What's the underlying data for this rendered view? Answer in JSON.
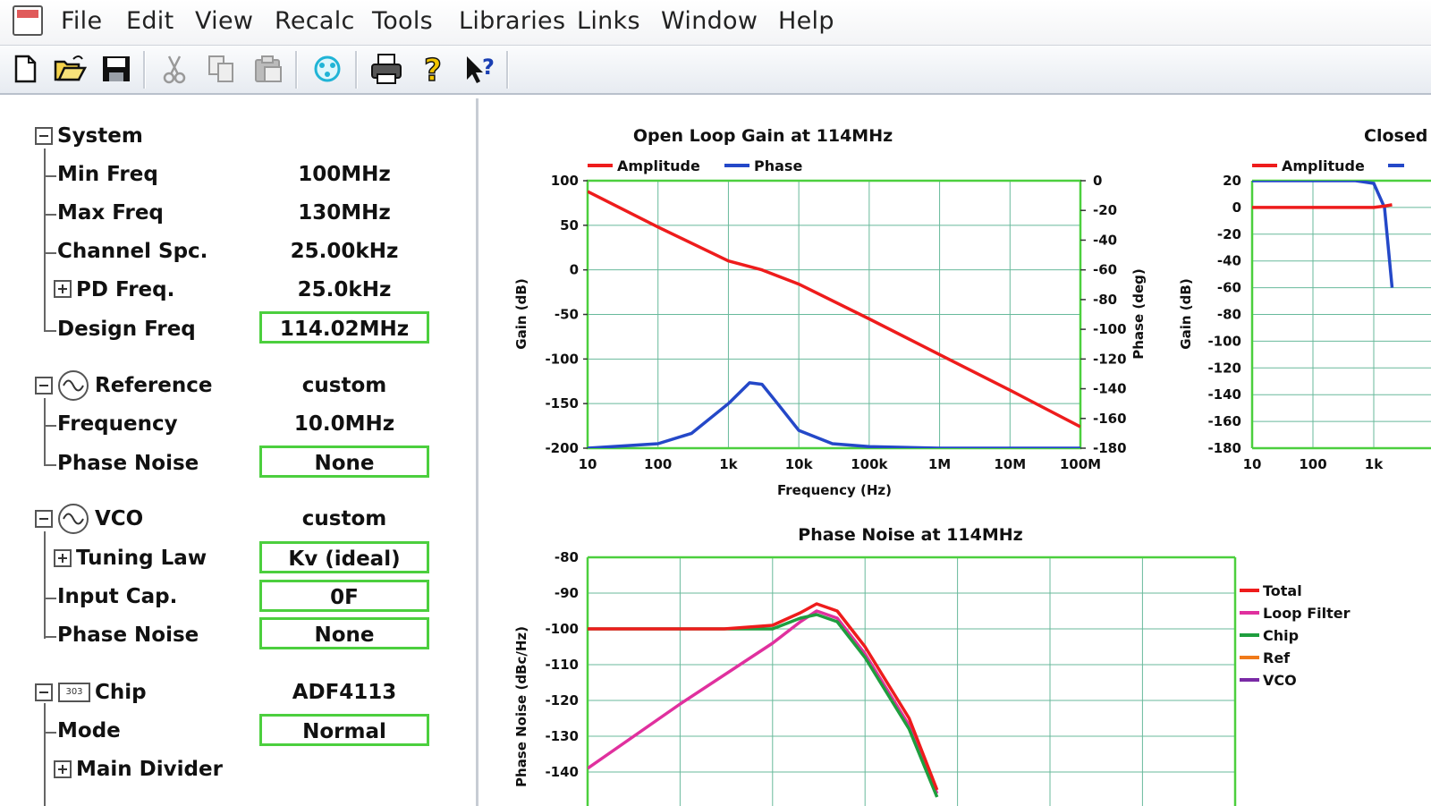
{
  "menu": [
    "File",
    "Edit",
    "View",
    "Recalc",
    "Tools",
    "Libraries",
    "Links",
    "Window",
    "Help"
  ],
  "toolbar": {
    "icons": [
      "new-file-icon",
      "open-folder-icon",
      "save-icon",
      "cut-icon",
      "copy-icon",
      "paste-icon",
      "calculate-icon",
      "print-icon",
      "help-icon",
      "context-help-icon"
    ]
  },
  "tree": {
    "system": {
      "label": "System",
      "rows": [
        {
          "label": "Min Freq",
          "value": "100MHz",
          "boxed": false
        },
        {
          "label": "Max Freq",
          "value": "130MHz",
          "boxed": false
        },
        {
          "label": "Channel Spc.",
          "value": "25.00kHz",
          "boxed": false
        },
        {
          "label": "PD Freq.",
          "value": "25.0kHz",
          "boxed": false
        },
        {
          "label": "Design Freq",
          "value": "114.02MHz",
          "boxed": true
        }
      ]
    },
    "reference": {
      "label": "Reference",
      "value": "custom",
      "rows": [
        {
          "label": "Frequency",
          "value": "10.0MHz",
          "boxed": false
        },
        {
          "label": "Phase Noise",
          "value": "None",
          "boxed": true
        }
      ]
    },
    "vco": {
      "label": "VCO",
      "value": "custom",
      "rows": [
        {
          "label": "Tuning Law",
          "value": "Kv (ideal)",
          "boxed": true
        },
        {
          "label": "Input Cap.",
          "value": "0F",
          "boxed": true
        },
        {
          "label": "Phase Noise",
          "value": "None",
          "boxed": true
        }
      ]
    },
    "chip": {
      "label": "Chip",
      "value": "ADF4113",
      "icon_text": "303",
      "rows": [
        {
          "label": "Mode",
          "value": "Normal",
          "boxed": true
        },
        {
          "label": "Main Divider",
          "value": "",
          "boxed": false
        }
      ]
    }
  },
  "colors": {
    "amplitude": "#ee1c1c",
    "phase": "#2448c8",
    "total": "#ee1c1c",
    "loop_filter": "#e0309e",
    "chip": "#1e9e3e",
    "ref": "#f07a1a",
    "vco": "#7a2aa6",
    "grid": "#68b99b",
    "frame": "#4ccf3e"
  },
  "chart_data": [
    {
      "type": "line",
      "title": "Open Loop Gain at  114MHz",
      "xlabel": "Frequency (Hz)",
      "ylabel": "Gain (dB)",
      "y2label": "Phase (deg)",
      "xscale": "log",
      "x_ticks": [
        "10",
        "100",
        "1k",
        "10k",
        "100k",
        "1M",
        "10M",
        "100M"
      ],
      "y_ticks": [
        "100",
        "50",
        "0",
        "-50",
        "-100",
        "-150",
        "-200"
      ],
      "y2_ticks": [
        "0",
        "-20",
        "-40",
        "-60",
        "-80",
        "-100",
        "-120",
        "-140",
        "-160",
        "-180"
      ],
      "ylim": [
        -200,
        100
      ],
      "y2lim": [
        -180,
        0
      ],
      "legend_position": "top-left",
      "series": [
        {
          "name": "Amplitude",
          "axis": "left",
          "x": [
            10,
            100,
            1000,
            3000,
            10000,
            100000,
            1000000,
            10000000,
            100000000
          ],
          "values": [
            88,
            48,
            10,
            0,
            -16,
            -55,
            -95,
            -135,
            -176
          ]
        },
        {
          "name": "Phase",
          "axis": "right",
          "x": [
            10,
            100,
            300,
            1000,
            2000,
            3000,
            5000,
            10000,
            30000,
            100000,
            1000000,
            10000000,
            100000000
          ],
          "values": [
            -180,
            -177,
            -170,
            -150,
            -136,
            -137,
            -150,
            -168,
            -177,
            -179,
            -180,
            -180,
            -180
          ]
        }
      ]
    },
    {
      "type": "line",
      "title": "Closed",
      "ylabel": "Gain (dB)",
      "xscale": "log",
      "x_ticks": [
        "10",
        "100",
        "1k"
      ],
      "y_ticks": [
        "20",
        "0",
        "-20",
        "-40",
        "-60",
        "-80",
        "-100",
        "-120",
        "-140",
        "-160",
        "-180"
      ],
      "ylim": [
        -180,
        20
      ],
      "legend_position": "top-left",
      "series": [
        {
          "name": "Amplitude",
          "x": [
            10,
            100,
            1000,
            1500,
            2000
          ],
          "values": [
            0,
            0,
            0,
            1,
            2
          ]
        },
        {
          "name": "",
          "x": [
            10,
            100,
            500,
            1000,
            1500,
            2000
          ],
          "values": [
            20,
            20,
            20,
            18,
            0,
            -60
          ]
        }
      ]
    },
    {
      "type": "line",
      "title": "Phase Noise at  114MHz",
      "ylabel": "Phase Noise (dBc/Hz)",
      "xscale": "log",
      "y_ticks": [
        "-80",
        "-90",
        "-100",
        "-110",
        "-120",
        "-130",
        "-140"
      ],
      "ylim": [
        -143,
        -80
      ],
      "legend_position": "right",
      "series": [
        {
          "name": "Total",
          "x": [
            10,
            100,
            300,
            1000,
            2000,
            3000,
            5000,
            10000,
            30000,
            60000
          ],
          "values": [
            -100,
            -100,
            -100,
            -99,
            -95.5,
            -93,
            -95,
            -105,
            -125,
            -145
          ]
        },
        {
          "name": "Loop Filter",
          "x": [
            10,
            100,
            1000,
            2000,
            3000,
            5000,
            10000,
            30000,
            60000
          ],
          "values": [
            -139,
            -121,
            -104,
            -98,
            -95,
            -97,
            -107,
            -127,
            -146
          ]
        },
        {
          "name": "Chip",
          "x": [
            10,
            100,
            300,
            1000,
            2000,
            3000,
            5000,
            10000,
            30000,
            60000
          ],
          "values": [
            -100,
            -100,
            -100,
            -100,
            -97,
            -96,
            -98,
            -108,
            -128,
            -147
          ]
        },
        {
          "name": "Ref",
          "x": [],
          "values": []
        },
        {
          "name": "VCO",
          "x": [],
          "values": []
        }
      ]
    }
  ]
}
